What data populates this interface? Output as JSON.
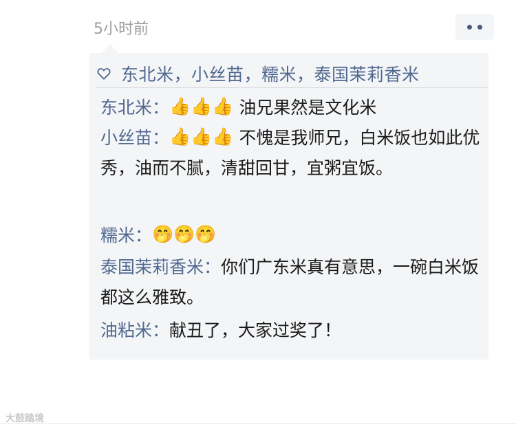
{
  "post": {
    "timestamp": "5小时前"
  },
  "likes": {
    "text": "东北米，小丝苗，糯米，泰国茉莉香米"
  },
  "comments": [
    {
      "author": "东北米",
      "sep": "：",
      "emoji": "👍👍👍",
      "text": "  油兄果然是文化米"
    },
    {
      "author": "小丝苗",
      "sep": "：",
      "emoji": "👍👍👍",
      "text": " 不愧是我师兄，白米饭也如此优秀，油而不腻，清甜回甘，宜粥宜饭。"
    },
    {
      "author": "糯米",
      "sep": "：",
      "emoji": "🤭🤭🤭",
      "text": ""
    },
    {
      "author": "泰国茉莉香米",
      "sep": "：",
      "emoji": "",
      "text": "你们广东米真有意思，一碗白米饭都这么雅致。"
    },
    {
      "author": "油粘米",
      "sep": "：",
      "emoji": "",
      "text": "献丑了，大家过奖了！"
    }
  ],
  "watermark": "大鼓踏境",
  "icons": {
    "more": "more-dots-icon",
    "like": "heart-outline-icon",
    "thumbs": "thumbs-up-icon",
    "face": "face-hand-over-mouth-icon"
  },
  "colors": {
    "name": "#506890",
    "panel": "#f4f5f7",
    "time": "#9e9e9e"
  }
}
